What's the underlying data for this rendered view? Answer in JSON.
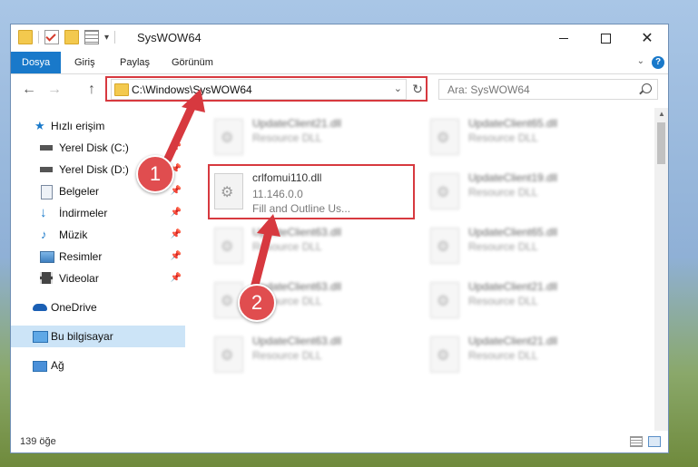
{
  "window": {
    "title": "SysWOW64",
    "qat_dropdown": "▾"
  },
  "ribbon": {
    "tabs": [
      "Dosya",
      "Giriş",
      "Paylaş",
      "Görünüm"
    ],
    "help": "?"
  },
  "nav": {
    "back": "←",
    "forward": "→",
    "up": "↑",
    "address": "C:\\Windows\\SysWOW64",
    "dropdown": "⌄",
    "refresh": "↻",
    "search_placeholder": "Ara: SysWOW64"
  },
  "sidebar": {
    "items": [
      {
        "label": "Hızlı erişim",
        "icon": "star-icon"
      },
      {
        "label": "Yerel Disk (C:)",
        "icon": "drive-icon"
      },
      {
        "label": "Yerel Disk (D:)",
        "icon": "drive-icon"
      },
      {
        "label": "Belgeler",
        "icon": "documents-icon"
      },
      {
        "label": "İndirmeler",
        "icon": "download-icon"
      },
      {
        "label": "Müzik",
        "icon": "music-icon"
      },
      {
        "label": "Resimler",
        "icon": "pictures-icon"
      },
      {
        "label": "Videolar",
        "icon": "videos-icon"
      },
      {
        "label": "OneDrive",
        "icon": "cloud-icon"
      },
      {
        "label": "Bu bilgisayar",
        "icon": "computer-icon"
      },
      {
        "label": "Ağ",
        "icon": "network-icon"
      }
    ]
  },
  "files": {
    "highlighted": {
      "name": "crlfomui110.dll",
      "version": "11.146.0.0",
      "description": "Fill and Outline Us..."
    },
    "blurred": [
      {
        "name": "UpdateClient21.dll",
        "type": "Resource DLL"
      },
      {
        "name": "UpdateClient65.dll",
        "type": "Resource DLL"
      },
      {
        "name": "UpdateClient19.dll",
        "type": "Resource DLL"
      },
      {
        "name": "UpdateClient63.dll",
        "type": "Resource DLL"
      },
      {
        "name": "UpdateClient65.dll",
        "type": "Resource DLL"
      },
      {
        "name": "UpdateClient63.dll",
        "type": "Resource DLL"
      },
      {
        "name": "UpdateClient21.dll",
        "type": "Resource DLL"
      },
      {
        "name": "UpdateClient63.dll",
        "type": "Resource DLL"
      },
      {
        "name": "UpdateClient21.dll",
        "type": "Resource DLL"
      }
    ]
  },
  "status": {
    "count": "139 öğe"
  },
  "callouts": {
    "one": "1",
    "two": "2"
  },
  "colors": {
    "accent": "#1979ca",
    "callout_red": "#d7393f",
    "selected_bg": "#cce4f7"
  }
}
